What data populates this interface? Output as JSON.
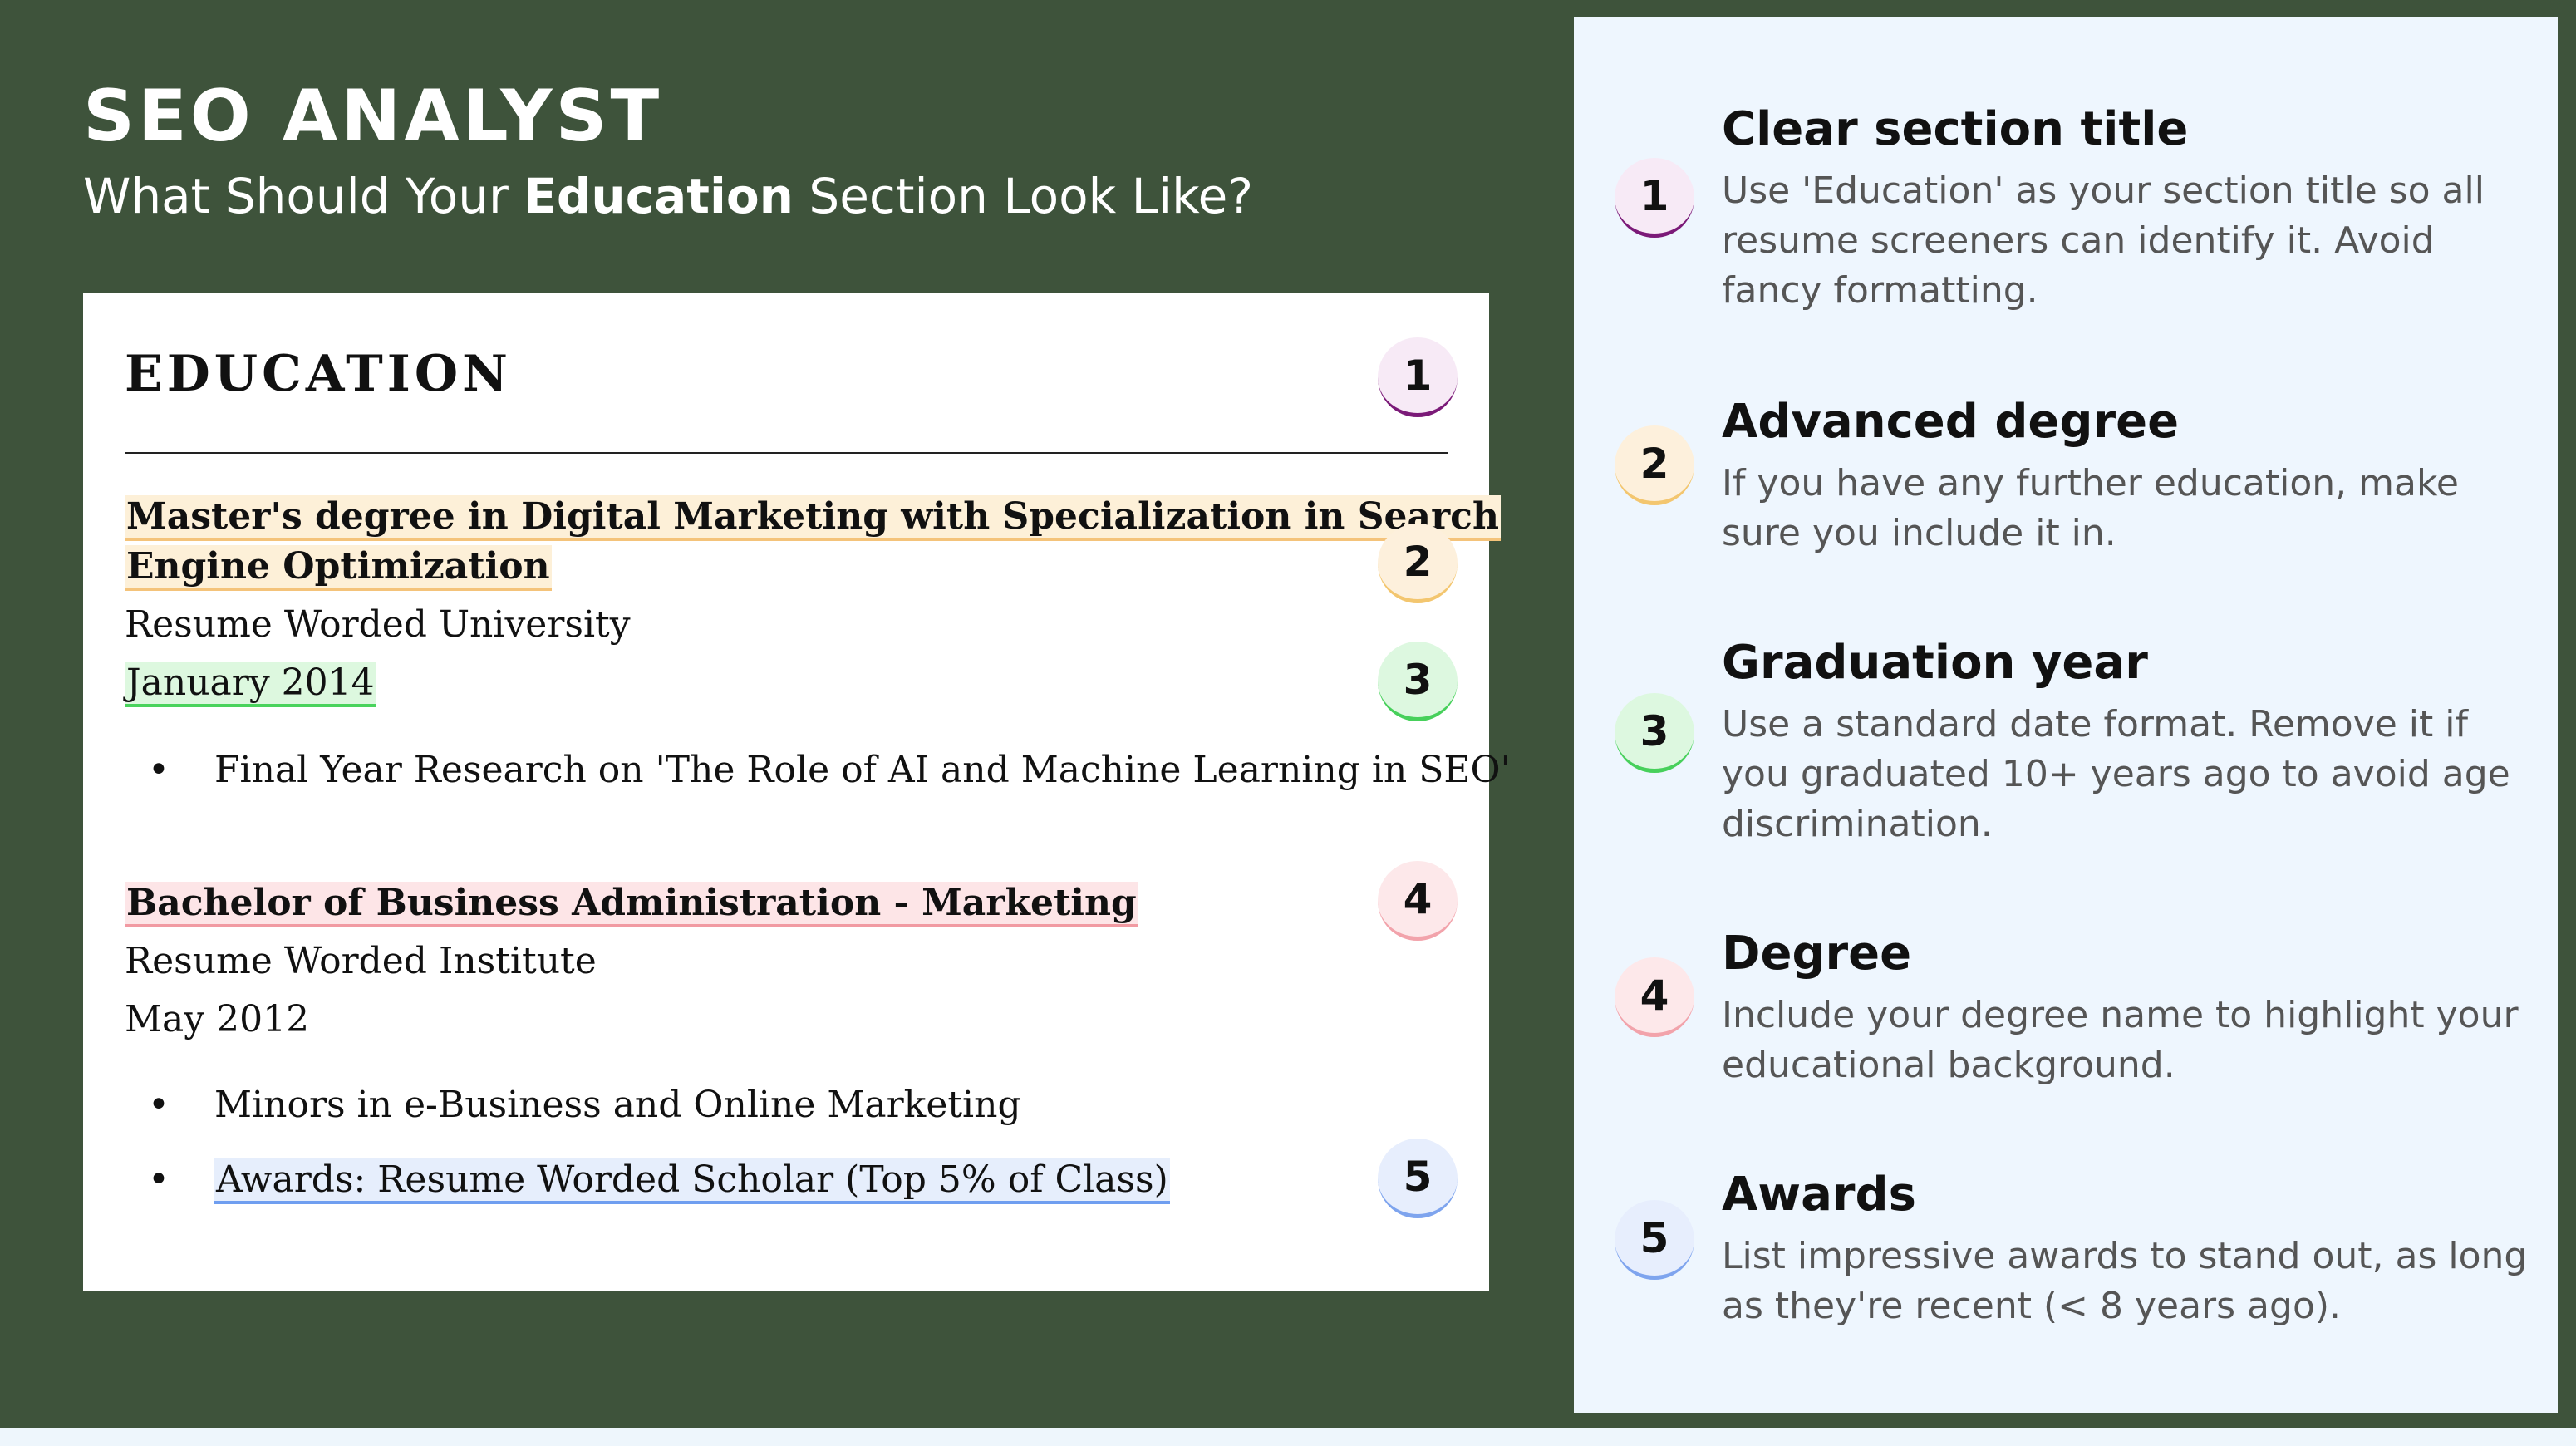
{
  "header": {
    "title": "SEO ANALYST",
    "subtitle_prefix": "What Should Your ",
    "subtitle_bold": "Education",
    "subtitle_suffix": " Section Look Like?"
  },
  "resume": {
    "section_heading": "EDUCATION",
    "entries": [
      {
        "degree_line1": "Master's degree in Digital Marketing with Specialization in Search",
        "degree_line2": "Engine Optimization",
        "school": "Resume Worded University",
        "date": "January 2014",
        "bullets": [
          "Final Year Research on 'The Role of AI and Machine Learning in SEO'"
        ]
      },
      {
        "degree_line1": "Bachelor of Business Administration - Marketing",
        "school": "Resume Worded Institute",
        "date": "May 2012",
        "bullets": [
          "Minors in e-Business and Online Marketing",
          "Awards: Resume Worded Scholar (Top 5% of Class)"
        ]
      }
    ],
    "bullet_glyph": "•"
  },
  "badges": [
    "1",
    "2",
    "3",
    "4",
    "5"
  ],
  "tips": [
    {
      "number": "1",
      "title": "Clear section title",
      "description": "Use 'Education' as your section title so all resume screeners can identify it. Avoid fancy formatting."
    },
    {
      "number": "2",
      "title": "Advanced degree",
      "description": "If you have any further education, make sure you include it in."
    },
    {
      "number": "3",
      "title": "Graduation year",
      "description": "Use a standard date format. Remove it if you graduated 10+ years ago to avoid age discrimination."
    },
    {
      "number": "4",
      "title": "Degree",
      "description": "Include your degree name to highlight your educational background."
    },
    {
      "number": "5",
      "title": "Awards",
      "description": "List impressive awards to stand out, as long as they're recent (< 8 years ago)."
    }
  ],
  "colors": {
    "background_green": "#3e533b",
    "panel_light": "#eef6fe",
    "accent_1": "#7b1a78",
    "accent_2": "#f3c66f",
    "accent_3": "#47d05b",
    "accent_4": "#f2a3ab",
    "accent_5": "#7ea4ee"
  }
}
